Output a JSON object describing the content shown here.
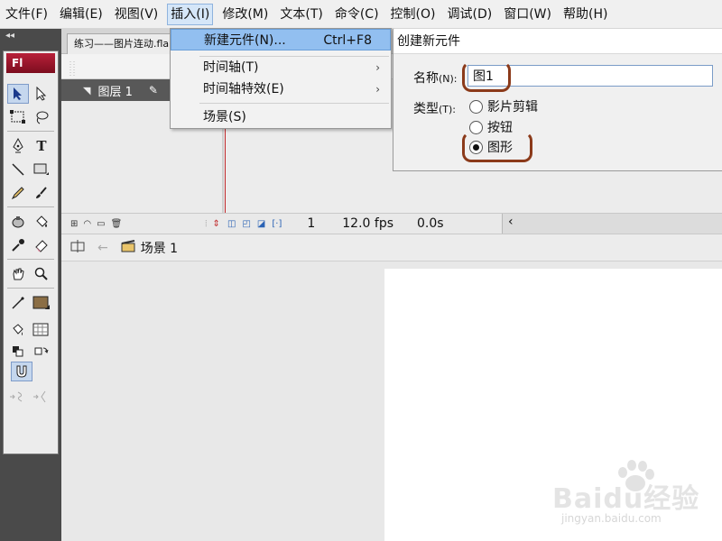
{
  "menubar": {
    "items": [
      "文件(F)",
      "编辑(E)",
      "视图(V)",
      "插入(I)",
      "修改(M)",
      "文本(T)",
      "命令(C)",
      "控制(O)",
      "调试(D)",
      "窗口(W)",
      "帮助(H)"
    ],
    "active_index": 3
  },
  "tool_panel": {
    "logo": "Fl",
    "collapse": "◂◂",
    "text_tool": "T"
  },
  "document": {
    "tab_label": "练习——图片连动.fla"
  },
  "timeline": {
    "layer_name": "图层 1",
    "current_frame": "1",
    "frame_rate": "12.0 fps",
    "elapsed_time": "0.0s"
  },
  "scene_bar": {
    "scene_name": "场景 1"
  },
  "insert_menu": {
    "items": [
      {
        "label": "新建元件(N)...",
        "shortcut": "Ctrl+F8",
        "highlighted": true
      },
      {
        "label": "时间轴(T)",
        "submenu": true
      },
      {
        "label": "时间轴特效(E)",
        "submenu": true
      },
      {
        "label": "场景(S)"
      }
    ],
    "submenu_arrow": "›"
  },
  "dialog": {
    "title": "创建新元件",
    "name_label": "名称",
    "name_shortcut": "(N):",
    "name_value": "图1",
    "type_label": "类型",
    "type_shortcut": "(T):",
    "types": [
      {
        "label": "影片剪辑",
        "checked": false
      },
      {
        "label": "按钮",
        "checked": false
      },
      {
        "label": "图形",
        "checked": true
      }
    ],
    "annotation_color": "#8b3a1a"
  },
  "watermark": {
    "text": "Baidu经验",
    "sub": "jingyan.baidu.com"
  }
}
